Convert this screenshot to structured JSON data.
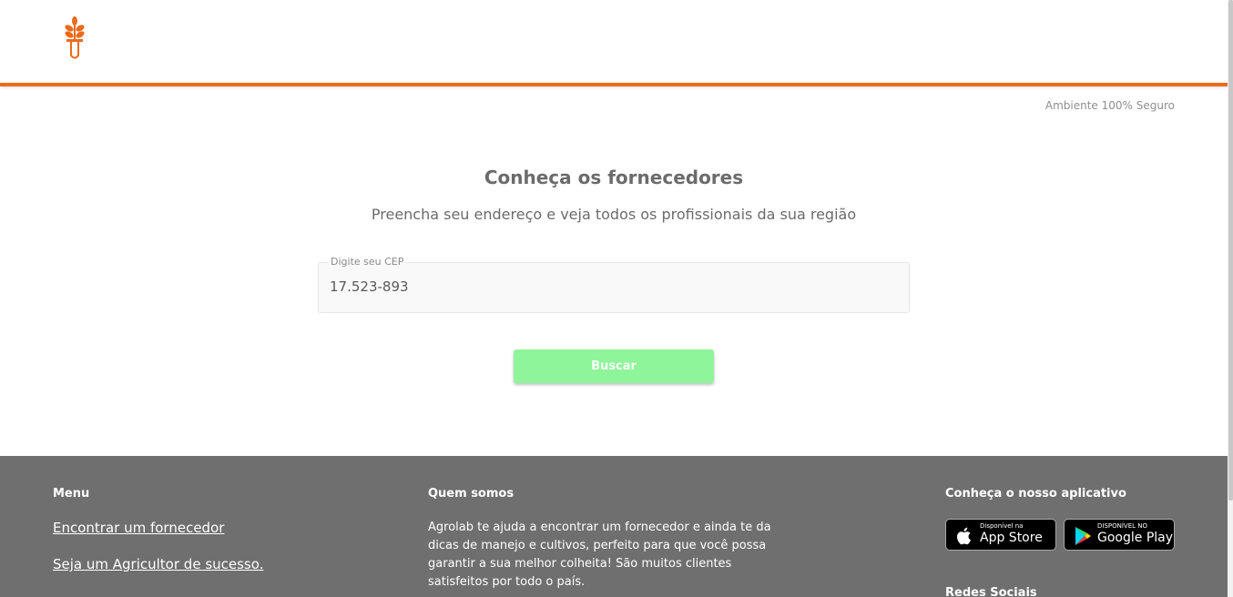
{
  "header": {
    "logo_icon": "plant-in-test-tube-icon",
    "accent_color": "#ed6a1a",
    "secure_label": "Ambiente 100% Seguro"
  },
  "main": {
    "title": "Conheça os fornecedores",
    "subtitle": "Preencha seu endereço e veja todos os profissionais da sua região",
    "cep_field": {
      "label": "Digite seu CEP",
      "value": "17.523-893"
    },
    "search_button_label": "Buscar",
    "button_color": "#8ff59a"
  },
  "footer": {
    "background_color": "#6f6f6f",
    "menu": {
      "heading": "Menu",
      "links": [
        "Encontrar um fornecedor",
        "Seja um Agricultor de sucesso."
      ]
    },
    "about": {
      "heading": "Quem somos",
      "text": "Agrolab te ajuda a encontrar um fornecedor e ainda te da dicas de manejo e cultivos, perfeito para que você possa garantir a sua melhor colheita! São muitos clientes satisfeitos por todo o país."
    },
    "app": {
      "heading": "Conheça o nosso aplicativo",
      "app_store": {
        "small": "Disponível na",
        "big": "App Store",
        "icon": "apple-icon"
      },
      "google_play": {
        "small": "DISPONÍVEL NO",
        "big": "Google Play",
        "icon": "google-play-icon"
      },
      "social_heading": "Redes Sociais"
    }
  }
}
